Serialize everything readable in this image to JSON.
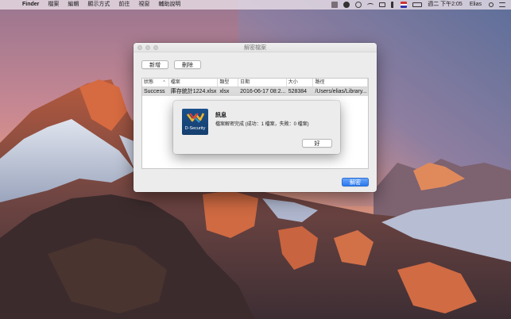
{
  "menubar": {
    "apple": "",
    "items": [
      "Finder",
      "檔案",
      "編輯",
      "顯示方式",
      "前往",
      "視窗",
      "輔助說明"
    ],
    "clock": "週二 下午2:05",
    "user": "Elias",
    "right_icons": [
      "app-status-icon",
      "shield-icon",
      "compass-icon",
      "wifi-icon",
      "display-icon",
      "volume-icon",
      "flag-icon",
      "battery-icon",
      "search-icon",
      "list-icon"
    ]
  },
  "window": {
    "title": "解密檔案",
    "add_label": "新增",
    "delete_label": "刪除",
    "decrypt_label": "解密",
    "table": {
      "headers": [
        "狀態",
        "檔案",
        "類型",
        "日期",
        "大小",
        "路徑"
      ],
      "rows": [
        [
          "Success",
          "庫存統計1224.xlsx",
          "xlsx",
          "2016-06-17 08:2...",
          "528384",
          "/Users/elias/Library..."
        ]
      ]
    }
  },
  "alert": {
    "title": "訊息",
    "message": "檔案解密完成 (成功：1 檔案，失敗：0 檔案)",
    "ok_label": "好",
    "icon_brand": "D-Security"
  },
  "colors": {
    "accent": "#2a78ef",
    "sky_top": "#ad7e98",
    "sky_warm": "#e58a6c"
  }
}
